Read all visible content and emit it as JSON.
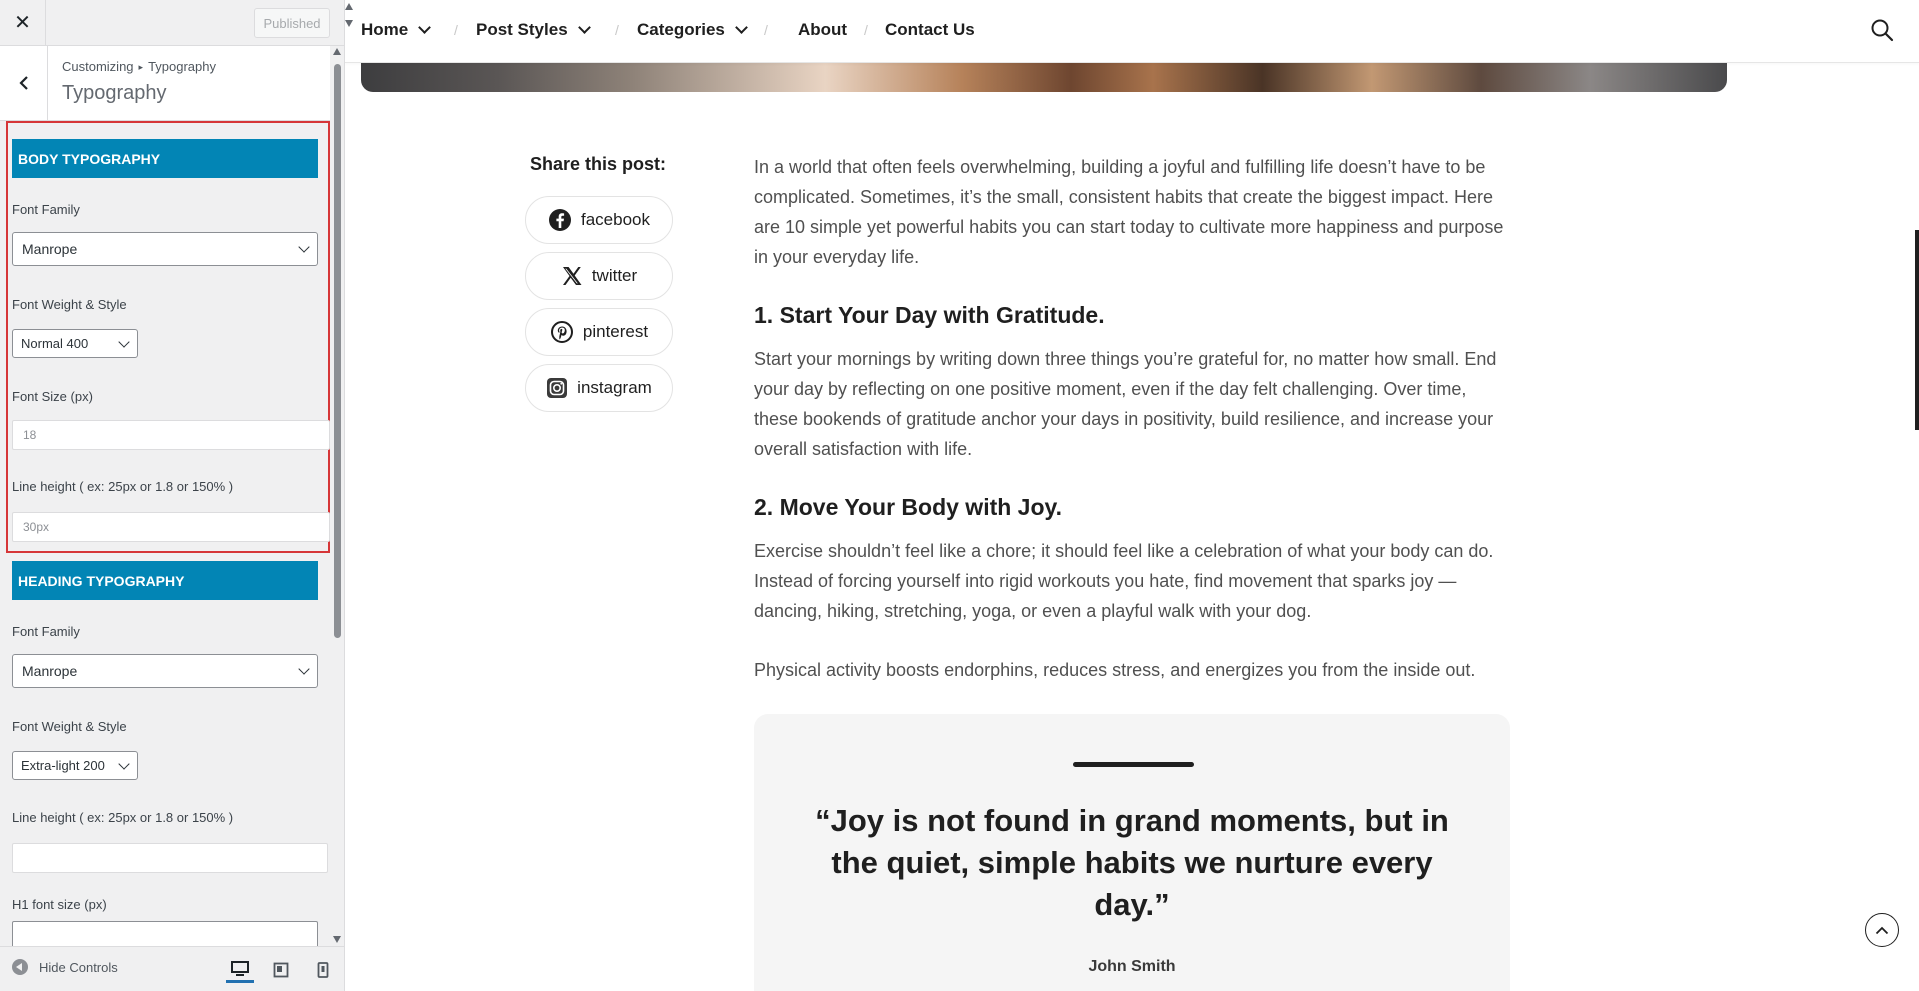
{
  "customizer": {
    "close_label": "✕",
    "publish_label": "Published",
    "breadcrumb": {
      "root": "Customizing",
      "separator": "▸",
      "current": "Typography"
    },
    "panel_title": "Typography",
    "body_typography": {
      "section_title": "BODY TYPOGRAPHY",
      "font_family_label": "Font Family",
      "font_family_value": "Manrope",
      "font_weight_label": "Font Weight & Style",
      "font_weight_value": "Normal 400",
      "font_size_label": "Font Size (px)",
      "font_size_placeholder": "18",
      "line_height_label": "Line height ( ex: 25px or 1.8 or 150% )",
      "line_height_placeholder": "30px"
    },
    "heading_typography": {
      "section_title": "HEADING TYPOGRAPHY",
      "font_family_label": "Font Family",
      "font_family_value": "Manrope",
      "font_weight_label": "Font Weight & Style",
      "font_weight_value": "Extra-light 200",
      "line_height_label": "Line height ( ex: 25px or 1.8 or 150% )",
      "line_height_value": "",
      "h1_size_label": "H1 font size (px)",
      "h1_size_value": ""
    },
    "footer": {
      "hide_controls_label": "Hide Controls",
      "devices": [
        "desktop",
        "tablet",
        "mobile"
      ],
      "active_device": "desktop"
    },
    "accent_color": "#0285b5",
    "highlight_color": "#d63638"
  },
  "preview": {
    "nav": {
      "items": [
        {
          "label": "Home",
          "has_dropdown": true
        },
        {
          "label": "Post Styles",
          "has_dropdown": true
        },
        {
          "label": "Categories",
          "has_dropdown": true
        },
        {
          "label": "About",
          "has_dropdown": false
        },
        {
          "label": "Contact Us",
          "has_dropdown": false
        }
      ],
      "separator": "/",
      "search_icon": "search-icon"
    },
    "share": {
      "title": "Share this post:",
      "buttons": [
        {
          "label": "facebook",
          "icon": "facebook-icon"
        },
        {
          "label": "twitter",
          "icon": "x-twitter-icon"
        },
        {
          "label": "pinterest",
          "icon": "pinterest-icon"
        },
        {
          "label": "instagram",
          "icon": "instagram-icon"
        }
      ]
    },
    "article": {
      "intro": "In a world that often feels overwhelming, building a joyful and fulfilling life doesn’t have to be complicated. Sometimes, it’s the small, consistent habits that create the biggest impact. Here are 10 simple yet powerful habits you can start today to cultivate more happiness and purpose in your everyday life.",
      "heading1": "1. Start Your Day with Gratitude.",
      "para1": "Start your mornings by writing down three things you’re grateful for, no matter how small. End your day by reflecting on one positive moment, even if the day felt challenging. Over time, these bookends of gratitude anchor your days in positivity, build resilience, and increase your overall satisfaction with life.",
      "heading2": "2. Move Your Body with Joy.",
      "para2": "Exercise shouldn’t feel like a chore; it should feel like a celebration of what your body can do. Instead of forcing yourself into rigid workouts you hate, find movement that sparks joy — dancing, hiking, stretching, yoga, or even a playful walk with your dog.",
      "para3": "Physical activity boosts endorphins, reduces stress, and energizes you from the inside out.",
      "quote": "“Joy is not found in grand moments, but in the quiet, simple habits we nurture every day.”",
      "quote_author": "John Smith"
    },
    "scroll_top_icon": "arrow-up-icon"
  }
}
